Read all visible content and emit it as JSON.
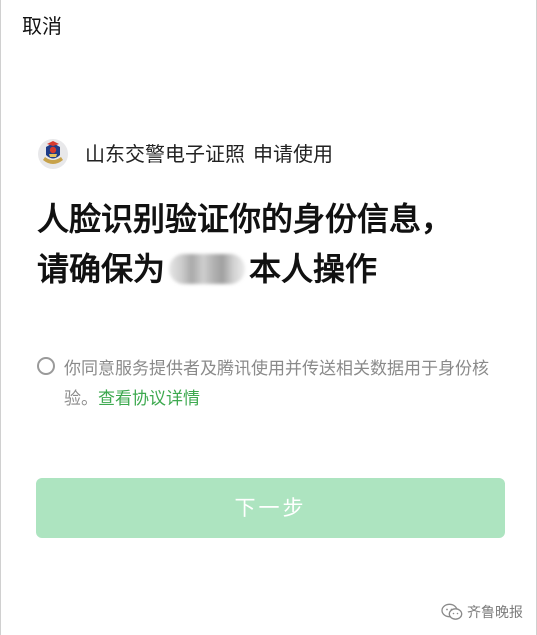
{
  "header": {
    "cancel_label": "取消"
  },
  "app": {
    "name": "山东交警电子证照",
    "action": "申请使用",
    "logo_icon": "police-badge-icon"
  },
  "headline": {
    "line1": "人脸识别验证你的身份信息，",
    "line2_prefix": "请确保为",
    "line2_suffix": "本人操作"
  },
  "agreement": {
    "text": "你同意服务提供者及腾讯使用并传送相关数据用于身份核验。",
    "link_text": "查看协议详情",
    "checked": false
  },
  "next_button": {
    "label": "下一步",
    "enabled": false
  },
  "watermark": {
    "text": "齐鲁晚报",
    "icon": "wechat-icon"
  },
  "colors": {
    "link": "#3da94f",
    "button_disabled": "#ade4c0",
    "secondary_text": "#8a8a8a"
  }
}
